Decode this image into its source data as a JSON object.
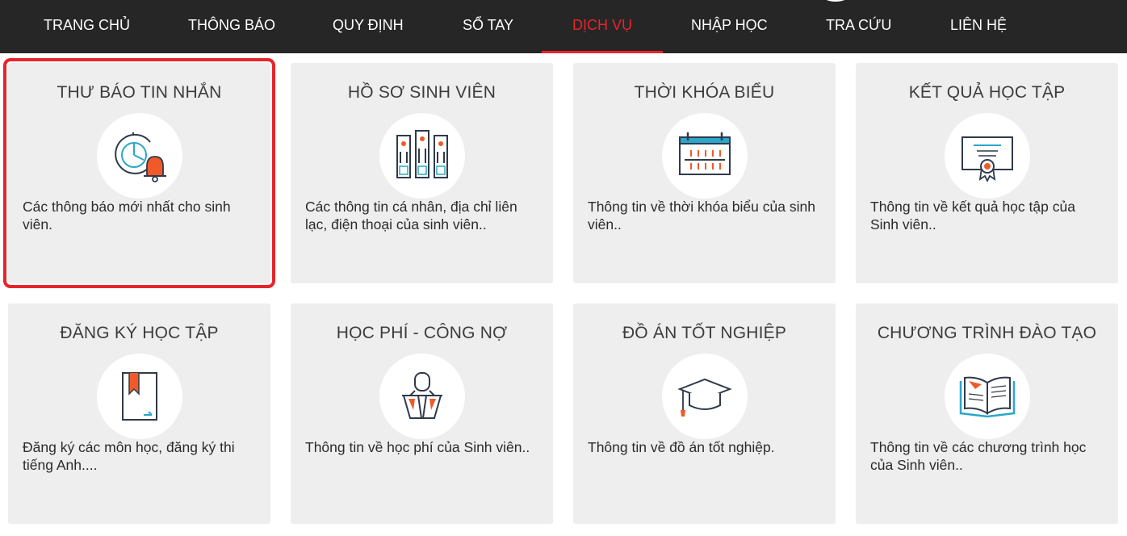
{
  "nav": {
    "items": [
      {
        "label": "TRANG CHỦ"
      },
      {
        "label": "THÔNG BÁO"
      },
      {
        "label": "QUY ĐỊNH"
      },
      {
        "label": "SỔ TAY"
      },
      {
        "label": "DỊCH VỤ",
        "active": true
      },
      {
        "label": "NHẬP HỌC"
      },
      {
        "label": "TRA CỨU"
      },
      {
        "label": "LIÊN HỆ"
      }
    ]
  },
  "colors": {
    "nav_bg": "#262626",
    "accent": "#e8242c",
    "card_bg": "#eeeeee",
    "icon_line": "#2f3a4a",
    "icon_orange": "#f05a28",
    "icon_teal": "#2aa7c9"
  },
  "cards": [
    {
      "title": "THƯ BÁO TIN NHẮN",
      "description": "Các thông báo mới nhất cho sinh viên.",
      "icon": "clock-bell-icon",
      "selected": true
    },
    {
      "title": "HỒ SƠ SINH VIÊN",
      "description": "Các thông tin cá nhân, địa chỉ liên lạc, điện thoại của sinh viên..",
      "icon": "binders-icon"
    },
    {
      "title": "THỜI KHÓA BIỂU",
      "description": "Thông tin về thời khóa biểu của sinh viên..",
      "icon": "calendar-icon"
    },
    {
      "title": "KẾT QUẢ HỌC TẬP",
      "description": "Thông tin về kết quả học tập của Sinh viên..",
      "icon": "certificate-icon"
    },
    {
      "title": "ĐĂNG KÝ HỌC TẬP",
      "description": "Đăng ký các môn học, đăng ký thi tiếng Anh....",
      "icon": "bookmark-book-icon"
    },
    {
      "title": "HỌC PHÍ - CÔNG NỢ",
      "description": "Thông tin về học phí của Sinh viên..",
      "icon": "binder-clip-icon"
    },
    {
      "title": "ĐỒ ÁN TỐT NGHIỆP",
      "description": "Thông tin về đồ án tốt nghiệp.",
      "icon": "graduation-cap-icon"
    },
    {
      "title": "CHƯƠNG TRÌNH ĐÀO TẠO",
      "description": "Thông tin về các chương trình học của Sinh viên..",
      "icon": "open-book-icon"
    }
  ]
}
